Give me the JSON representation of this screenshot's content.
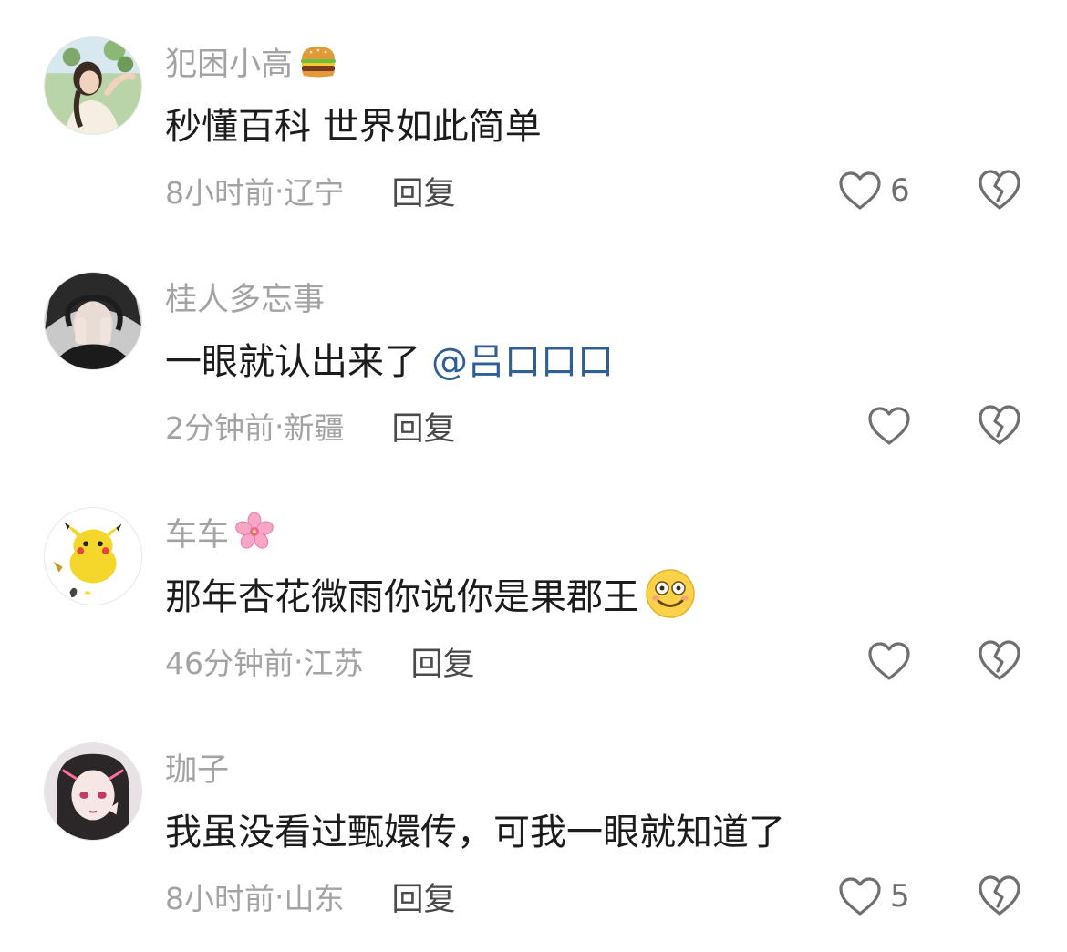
{
  "comments": [
    {
      "username": "犯困小高",
      "name_emoji": "hamburger-emoji",
      "text": "秒懂百科 世界如此简单",
      "mention": "",
      "inline_emoji": "",
      "time": "8小时前",
      "location": "辽宁",
      "reply_label": "回复",
      "likes": "6"
    },
    {
      "username": "桂人多忘事",
      "name_emoji": "",
      "text": "一眼就认出来了",
      "mention": "@吕口口口",
      "inline_emoji": "",
      "time": "2分钟前",
      "location": "新疆",
      "reply_label": "回复",
      "likes": ""
    },
    {
      "username": "车车",
      "name_emoji": "cherry-blossom-emoji",
      "text": "那年杏花微雨你说你是果郡王",
      "mention": "",
      "inline_emoji": "grinning-face-emoji",
      "time": "46分钟前",
      "location": "江苏",
      "reply_label": "回复",
      "likes": ""
    },
    {
      "username": "珈子",
      "name_emoji": "",
      "text": "我虽没看过甄嬛传，可我一眼就知道了",
      "mention": "",
      "inline_emoji": "",
      "time": "8小时前",
      "location": "山东",
      "reply_label": "回复",
      "likes": "5"
    }
  ],
  "separator": " · ",
  "icons": {
    "like": "heart-outline-icon",
    "dislike": "broken-heart-icon"
  },
  "colors": {
    "username": "#a3a3a3",
    "text": "#1c1c1c",
    "mention": "#2f5f94",
    "meta": "#a3a3a3",
    "icon": "#6f6f6f"
  }
}
